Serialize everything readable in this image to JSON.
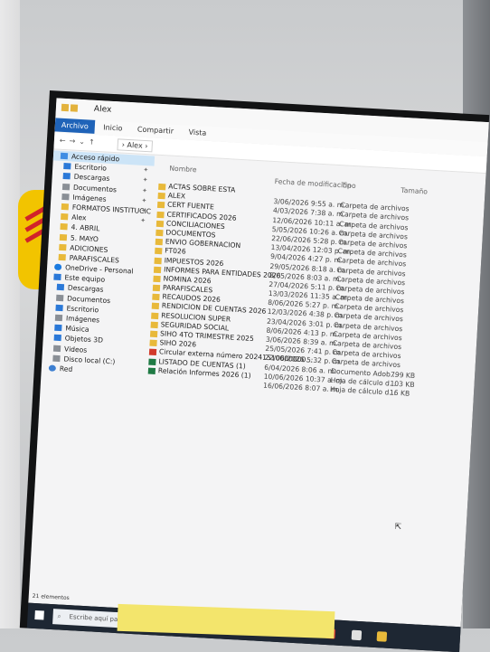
{
  "window": {
    "title": "Alex"
  },
  "ribbon": {
    "tabs": [
      "Archivo",
      "Inicio",
      "Compartir",
      "Vista"
    ]
  },
  "address": {
    "path": "Alex"
  },
  "sidebar": {
    "items": [
      {
        "label": "Acceso rápido",
        "icon": "star-icon",
        "pinned": false
      },
      {
        "label": "Escritorio",
        "icon": "desktop-icon",
        "pinned": true
      },
      {
        "label": "Descargas",
        "icon": "download-icon",
        "pinned": true
      },
      {
        "label": "Documentos",
        "icon": "documents-icon",
        "pinned": true
      },
      {
        "label": "Imágenes",
        "icon": "pictures-icon",
        "pinned": true
      },
      {
        "label": "FORMATOS INSTITUCIC",
        "icon": "folder-icon",
        "pinned": true
      },
      {
        "label": "Alex",
        "icon": "folder-icon",
        "pinned": true
      },
      {
        "label": "4. ABRIL",
        "icon": "folder-icon",
        "pinned": false
      },
      {
        "label": "5. MAYO",
        "icon": "folder-icon",
        "pinned": false
      },
      {
        "label": "ADICIONES",
        "icon": "folder-icon",
        "pinned": false
      },
      {
        "label": "PARAFISCALES",
        "icon": "folder-icon",
        "pinned": false
      },
      {
        "label": "OneDrive - Personal",
        "icon": "onedrive-icon",
        "pinned": false
      },
      {
        "label": "Este equipo",
        "icon": "computer-icon",
        "pinned": false
      },
      {
        "label": "Descargas",
        "icon": "download-icon",
        "pinned": false
      },
      {
        "label": "Documentos",
        "icon": "documents-icon",
        "pinned": false
      },
      {
        "label": "Escritorio",
        "icon": "desktop-icon",
        "pinned": false
      },
      {
        "label": "Imágenes",
        "icon": "pictures-icon",
        "pinned": false
      },
      {
        "label": "Música",
        "icon": "music-icon",
        "pinned": false
      },
      {
        "label": "Objetos 3D",
        "icon": "objects3d-icon",
        "pinned": false
      },
      {
        "label": "Videos",
        "icon": "videos-icon",
        "pinned": false
      },
      {
        "label": "Disco local (C:)",
        "icon": "drive-icon",
        "pinned": false
      },
      {
        "label": "Red",
        "icon": "network-icon",
        "pinned": false
      }
    ]
  },
  "columns": {
    "name": "Nombre",
    "date": "Fecha de modificación",
    "type": "Tipo",
    "size": "Tamaño"
  },
  "files": [
    {
      "name": "ACTAS SOBRE ESTA",
      "date": "",
      "type": "",
      "size": "",
      "kind": "folder"
    },
    {
      "name": "ALEX",
      "date": "3/06/2026 9:55 a. m.",
      "type": "Carpeta de archivos",
      "size": "",
      "kind": "folder"
    },
    {
      "name": "CERT FUENTE",
      "date": "4/03/2026 7:38 a. m.",
      "type": "Carpeta de archivos",
      "size": "",
      "kind": "folder"
    },
    {
      "name": "CERTIFICADOS 2026",
      "date": "12/06/2026 10:11 a. m.",
      "type": "Carpeta de archivos",
      "size": "",
      "kind": "folder"
    },
    {
      "name": "CONCILIACIONES",
      "date": "5/05/2026 10:26 a. m.",
      "type": "Carpeta de archivos",
      "size": "",
      "kind": "folder"
    },
    {
      "name": "DOCUMENTOS",
      "date": "22/06/2026 5:28 p. m.",
      "type": "Carpeta de archivos",
      "size": "",
      "kind": "folder"
    },
    {
      "name": "ENVIO GOBERNACION",
      "date": "13/04/2026 12:03 p. m.",
      "type": "Carpeta de archivos",
      "size": "",
      "kind": "folder"
    },
    {
      "name": "FT026",
      "date": "9/04/2026 4:27 p. m.",
      "type": "Carpeta de archivos",
      "size": "",
      "kind": "folder"
    },
    {
      "name": "IMPUESTOS 2026",
      "date": "29/05/2026 8:18 a. m.",
      "type": "Carpeta de archivos",
      "size": "",
      "kind": "folder"
    },
    {
      "name": "INFORMES PARA ENTIDADES 2026",
      "date": "8/05/2026 8:03 a. m.",
      "type": "Carpeta de archivos",
      "size": "",
      "kind": "folder"
    },
    {
      "name": "NOMINA 2026",
      "date": "27/04/2026 5:11 p. m.",
      "type": "Carpeta de archivos",
      "size": "",
      "kind": "folder"
    },
    {
      "name": "PARAFISCALES",
      "date": "13/03/2026 11:35 a. m.",
      "type": "Carpeta de archivos",
      "size": "",
      "kind": "folder"
    },
    {
      "name": "RECAUDOS 2026",
      "date": "8/06/2026 5:27 p. m.",
      "type": "Carpeta de archivos",
      "size": "",
      "kind": "folder"
    },
    {
      "name": "RENDICION DE CUENTAS 2026",
      "date": "12/03/2026 4:38 p. m.",
      "type": "Carpeta de archivos",
      "size": "",
      "kind": "folder"
    },
    {
      "name": "RESOLUCION SUPER",
      "date": "23/04/2026 3:01 p. m.",
      "type": "Carpeta de archivos",
      "size": "",
      "kind": "folder"
    },
    {
      "name": "SEGURIDAD SOCIAL",
      "date": "8/06/2026 4:13 p. m.",
      "type": "Carpeta de archivos",
      "size": "",
      "kind": "folder"
    },
    {
      "name": "SIHO 4TO TRIMESTRE 2025",
      "date": "3/06/2026 8:39 a. m.",
      "type": "Carpeta de archivos",
      "size": "",
      "kind": "folder"
    },
    {
      "name": "SIHO 2026",
      "date": "25/05/2026 7:41 p. m.",
      "type": "Carpeta de archivos",
      "size": "",
      "kind": "folder"
    },
    {
      "name": "Circular externa número 20241510000000...",
      "date": "22/06/2026 5:32 p. m.",
      "type": "Carpeta de archivos",
      "size": "",
      "kind": "pdf"
    },
    {
      "name": "LISTADO DE CUENTAS (1)",
      "date": "6/04/2026 8:06 a. m.",
      "type": "Documento Adob...",
      "size": "799 KB",
      "kind": "excel"
    },
    {
      "name": "Relación Informes 2026 (1)",
      "date": "10/06/2026 10:37 a. m.",
      "type": "Hoja de cálculo d...",
      "size": "103 KB",
      "kind": "excel"
    },
    {
      "name": "",
      "date": "16/06/2026 8:07 a. m.",
      "type": "Hoja de cálculo d...",
      "size": "16 KB",
      "kind": "none"
    }
  ],
  "status": {
    "count": "21 elementos"
  },
  "taskbar": {
    "search_placeholder": "Escribe aquí para buscar"
  }
}
